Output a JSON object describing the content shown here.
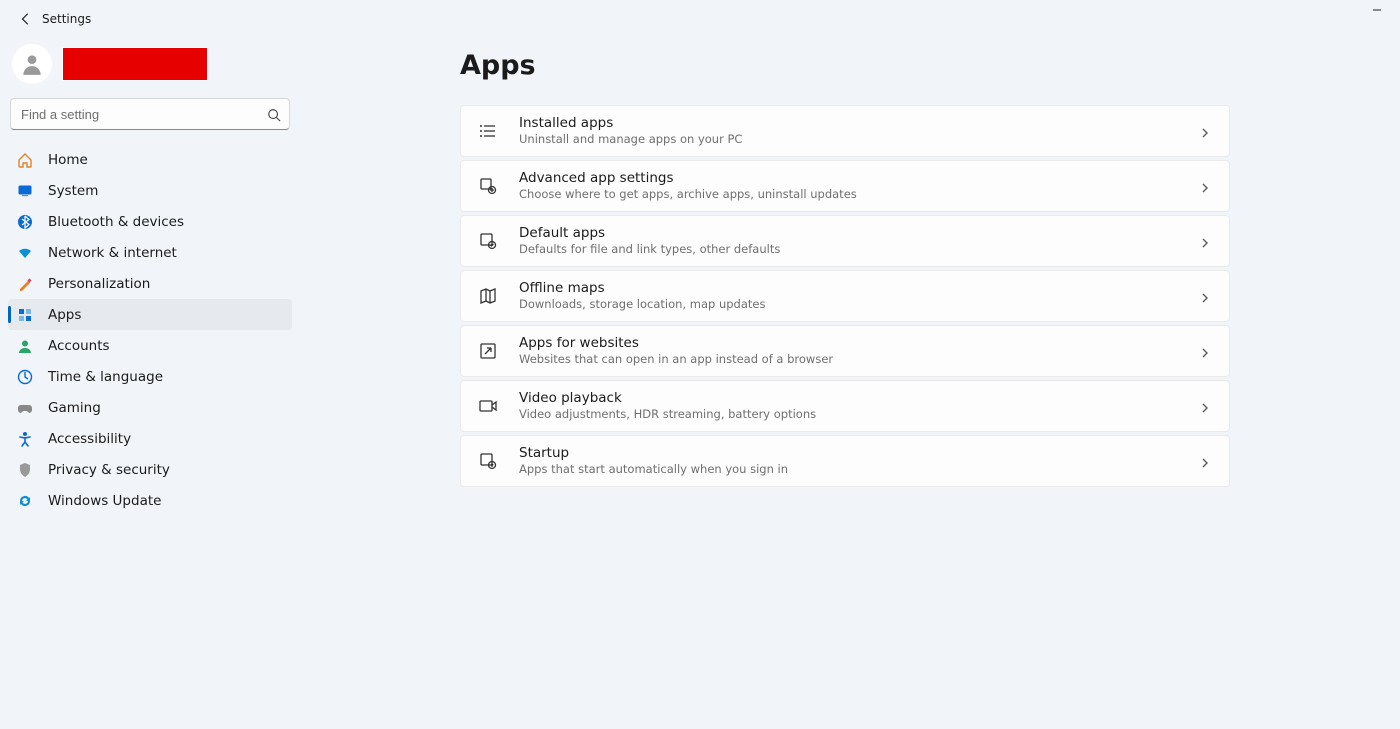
{
  "window": {
    "title": "Settings"
  },
  "search": {
    "placeholder": "Find a setting"
  },
  "nav": {
    "items": [
      {
        "label": "Home"
      },
      {
        "label": "System"
      },
      {
        "label": "Bluetooth & devices"
      },
      {
        "label": "Network & internet"
      },
      {
        "label": "Personalization"
      },
      {
        "label": "Apps"
      },
      {
        "label": "Accounts"
      },
      {
        "label": "Time & language"
      },
      {
        "label": "Gaming"
      },
      {
        "label": "Accessibility"
      },
      {
        "label": "Privacy & security"
      },
      {
        "label": "Windows Update"
      }
    ],
    "activeIndex": 5
  },
  "page": {
    "title": "Apps",
    "cards": [
      {
        "title": "Installed apps",
        "sub": "Uninstall and manage apps on your PC"
      },
      {
        "title": "Advanced app settings",
        "sub": "Choose where to get apps, archive apps, uninstall updates"
      },
      {
        "title": "Default apps",
        "sub": "Defaults for file and link types, other defaults"
      },
      {
        "title": "Offline maps",
        "sub": "Downloads, storage location, map updates"
      },
      {
        "title": "Apps for websites",
        "sub": "Websites that can open in an app instead of a browser"
      },
      {
        "title": "Video playback",
        "sub": "Video adjustments, HDR streaming, battery options"
      },
      {
        "title": "Startup",
        "sub": "Apps that start automatically when you sign in"
      }
    ]
  }
}
